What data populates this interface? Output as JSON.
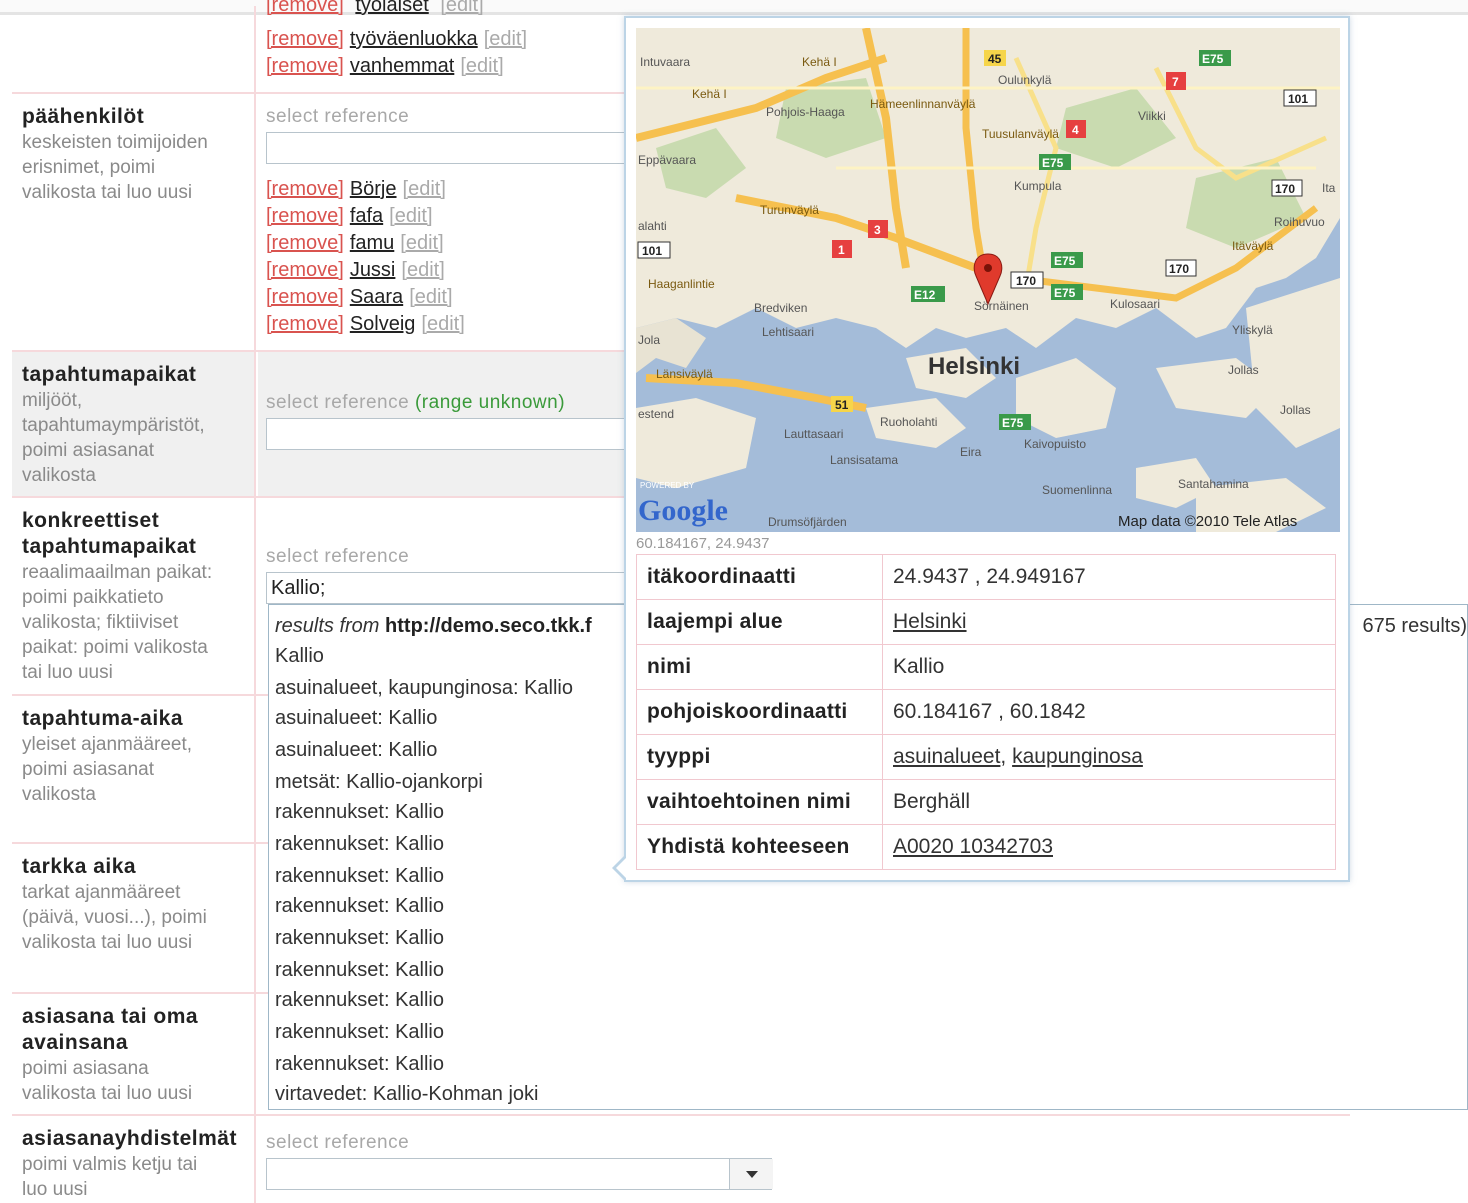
{
  "top_refs": [
    {
      "remove": "[remove]",
      "name": "työväenluokka",
      "edit": "[edit]"
    },
    {
      "remove": "[remove]",
      "name": "vanhemmat",
      "edit": "[edit]"
    }
  ],
  "fields": {
    "paahenkilot": {
      "title": "päähenkilöt",
      "desc1": "keskeisten toimijoiden",
      "desc2": "erisnimet, poimi",
      "desc3": "valikosta tai luo uusi",
      "select": "select reference",
      "refs": [
        {
          "remove": "[remove]",
          "name": "Börje",
          "edit": "[edit]"
        },
        {
          "remove": "[remove]",
          "name": "fafa",
          "edit": "[edit]"
        },
        {
          "remove": "[remove]",
          "name": "famu",
          "edit": "[edit]"
        },
        {
          "remove": "[remove]",
          "name": "Jussi",
          "edit": "[edit]"
        },
        {
          "remove": "[remove]",
          "name": "Saara",
          "edit": "[edit]"
        },
        {
          "remove": "[remove]",
          "name": "Solveig",
          "edit": "[edit]"
        }
      ]
    },
    "tapahtumapaikat": {
      "title": "tapahtumapaikat",
      "desc1": "miljööt,",
      "desc2": "tapahtumaympäristöt,",
      "desc3": "poimi asiasanat",
      "desc4": "valikosta",
      "select": "select reference",
      "range": "(range unknown)"
    },
    "konkreettiset": {
      "title1": "konkreettiset",
      "title2": "tapahtumapaikat",
      "desc1": "reaalimaailman paikat:",
      "desc2": "poimi paikkatieto",
      "desc3": "valikosta; fiktiiviset",
      "desc4": "paikat: poimi valikosta",
      "desc5": "tai luo uusi",
      "select": "select reference",
      "input_value": "Kallio;"
    },
    "tapahtuma_aika": {
      "title": "tapahtuma-aika",
      "desc1": "yleiset ajanmääreet,",
      "desc2": "poimi asiasanat",
      "desc3": "valikosta"
    },
    "tarkka_aika": {
      "title": "tarkka aika",
      "desc1": "tarkat ajanmääreet",
      "desc2": "(päivä, vuosi...), poimi",
      "desc3": "valikosta tai luo uusi"
    },
    "asiasana": {
      "title1": "asiasana tai oma",
      "title2": "avainsana",
      "desc1": "poimi asiasana",
      "desc2": "valikosta tai luo uusi"
    },
    "yhdistelmat": {
      "title": "asiasanayhdistelmät",
      "desc1": "poimi valmis ketju tai",
      "desc2": "luo uusi",
      "select": "select reference"
    }
  },
  "dropdown": {
    "results_from": "results from",
    "source": "http://demo.seco.tkk.f",
    "count": "675 results)",
    "items": [
      "Kallio",
      "asuinalueet, kaupunginosa: Kallio",
      "asuinalueet: Kallio",
      "asuinalueet: Kallio",
      "metsät: Kallio-ojankorpi",
      "rakennukset: Kallio",
      "rakennukset: Kallio",
      "rakennukset: Kallio",
      "rakennukset: Kallio",
      "rakennukset: Kallio",
      "rakennukset: Kallio",
      "rakennukset: Kallio",
      "rakennukset: Kallio",
      "rakennukset: Kallio",
      "virtavedet: Kallio-Kohman joki"
    ]
  },
  "popup": {
    "coords": "60.184167, 24.9437",
    "map": {
      "city": "Helsinki",
      "attribution": "Map data ©2010 Tele Atlas",
      "powered": "POWERED BY",
      "google": "Google",
      "places": [
        "Intuvaara",
        "Pohjois-Haaga",
        "Oulunkylä",
        "Viikki",
        "Kumpula",
        "Roihuvuo",
        "Bredviken",
        "Lehtisaari",
        "Kulosaari",
        "Yliskylä",
        "Jollas",
        "Lauttasaari",
        "Ruoholahti",
        "Kaivopuisto",
        "Lansisatama",
        "Eira",
        "Suomenlinna",
        "Santahamina",
        "Drumsöfjärden",
        "Sörnäinen",
        "Turunväylä",
        "Kehä I",
        "Länsiväylä",
        "Haaganlintie",
        "Hämeenlinnanväylä",
        "Tuusulanväylä",
        "Itäväylä",
        "Eppävaara",
        "alahti",
        "Jola",
        "estend",
        "Kehä I",
        "Ita"
      ],
      "shields": [
        "45",
        "E75",
        "101",
        "7",
        "4",
        "E75",
        "170",
        "3",
        "1",
        "101",
        "E75",
        "170",
        "170",
        "E12",
        "E75",
        "51",
        "E75"
      ]
    },
    "rows": [
      {
        "k": "itäkoordinaatti",
        "v": "24.9437 , 24.949167"
      },
      {
        "k": "laajempi alue",
        "links": [
          "Helsinki"
        ]
      },
      {
        "k": "nimi",
        "v": "Kallio"
      },
      {
        "k": "pohjoiskoordinaatti",
        "v": "60.184167 , 60.1842"
      },
      {
        "k": "tyyppi",
        "links": [
          "asuinalueet",
          "kaupunginosa"
        ]
      },
      {
        "k": "vaihtoehtoinen nimi",
        "v": "Berghäll"
      },
      {
        "k": "Yhdistä kohteeseen",
        "links": [
          "A0020 10342703"
        ]
      }
    ]
  }
}
